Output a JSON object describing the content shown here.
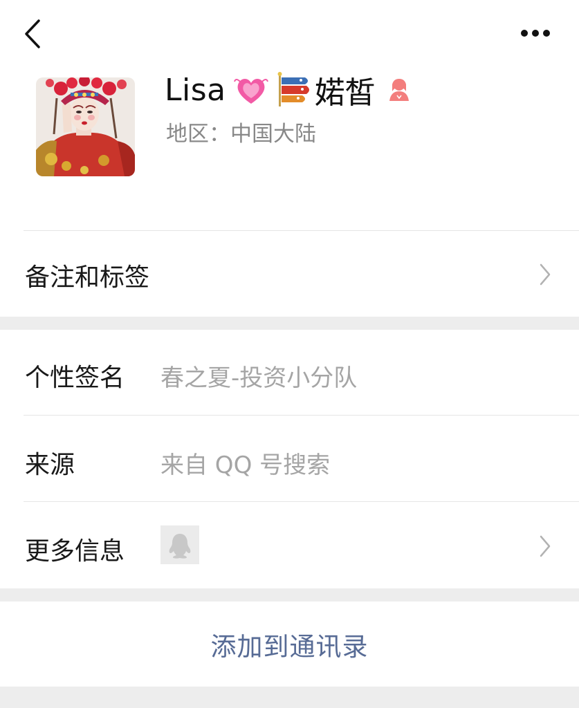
{
  "header": {
    "back_icon": "chevron-left-icon",
    "more_icon": "more-dots-icon"
  },
  "profile": {
    "name": "Lisa",
    "name_suffix": "婼皙",
    "emoji_1": "growing-heart-emoji",
    "emoji_2": "carp-streamer-emoji",
    "gender_icon": "female-icon",
    "gender_color": "#f37e7d",
    "region": "地区：中国大陆"
  },
  "remarks_row": {
    "label": "备注和标签"
  },
  "info_rows": [
    {
      "label": "个性签名",
      "value": "春之夏-投资小分队"
    },
    {
      "label": "来源",
      "value": "来自 QQ 号搜索"
    },
    {
      "label": "更多信息",
      "value": ""
    }
  ],
  "actions": {
    "add_to_contacts": "添加到通讯录"
  },
  "colors": {
    "background": "#ededed",
    "link": "#576b95",
    "secondary_text": "#a5a5a5"
  }
}
